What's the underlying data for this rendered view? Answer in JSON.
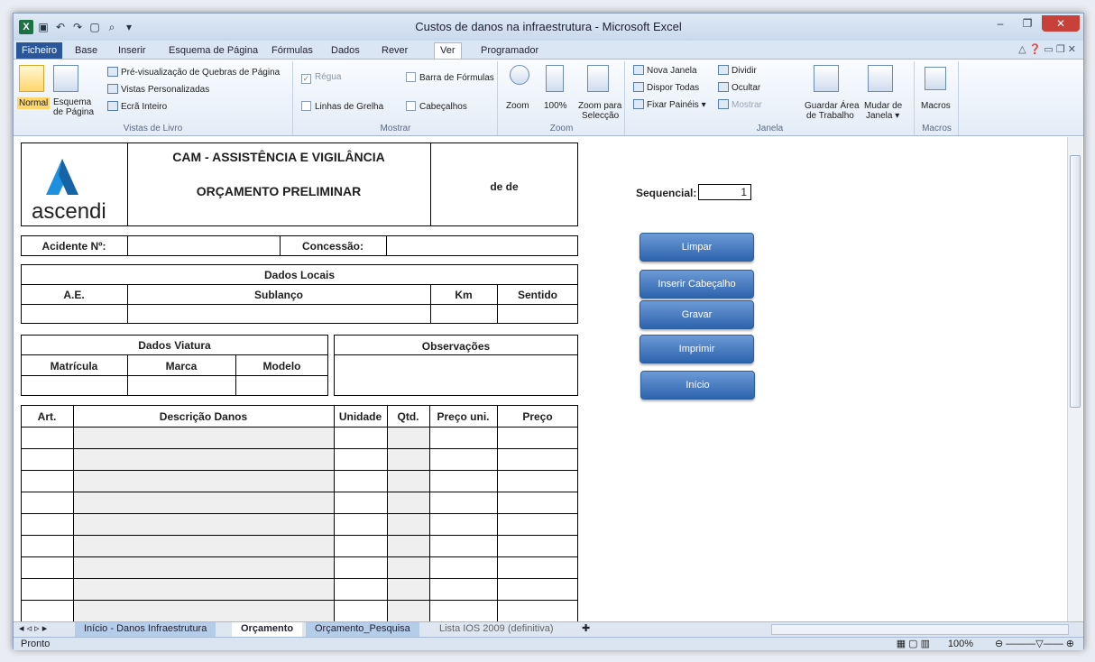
{
  "window": {
    "title": "Custos de danos na infraestrutura - Microsoft Excel"
  },
  "tabs": [
    "Base",
    "Inserir",
    "Esquema de Página",
    "Fórmulas",
    "Dados",
    "Rever",
    "Ver",
    "Programador"
  ],
  "file_tab": "Ficheiro",
  "ribbon": {
    "views": {
      "normal": "Normal",
      "page_layout_1": "Esquema",
      "page_layout_2": "de Página",
      "page_break": "Pré-visualização de Quebras de Página",
      "custom": "Vistas Personalizadas",
      "fullscreen": "Ecrã Inteiro",
      "label": "Vistas de Livro"
    },
    "show": {
      "ruler": "Régua",
      "formula_bar": "Barra de Fórmulas",
      "gridlines": "Linhas de Grelha",
      "headings": "Cabeçalhos",
      "label": "Mostrar"
    },
    "zoom": {
      "zoom": "Zoom",
      "hundred": "100%",
      "zoom_sel_1": "Zoom para",
      "zoom_sel_2": "Selecção",
      "label": "Zoom"
    },
    "window": {
      "new": "Nova Janela",
      "arrange": "Dispor Todas",
      "freeze": "Fixar Painéis ▾",
      "split": "Dividir",
      "hide": "Ocultar",
      "unhide": "Mostrar",
      "save_ws_1": "Guardar Área",
      "save_ws_2": "de Trabalho",
      "switch_1": "Mudar de",
      "switch_2": "Janela ▾",
      "label": "Janela"
    },
    "macros": {
      "macros": "Macros",
      "label": "Macros"
    }
  },
  "form": {
    "company": "CAM - ASSISTÊNCIA E VIGILÂNCIA",
    "doc_title": "ORÇAMENTO PRELIMINAR",
    "date": "de de",
    "logo": "ascendi",
    "accident_label": "Acidente Nº:",
    "concession_label": "Concessão:",
    "local_section": "Dados Locais",
    "local_cols": [
      "A.E.",
      "Sublanço",
      "Km",
      "Sentido"
    ],
    "vehicle_section": "Dados Viatura",
    "vehicle_cols": [
      "Matrícula",
      "Marca",
      "Modelo"
    ],
    "obs_label": "Observações",
    "damage_cols": [
      "Art.",
      "Descrição Danos",
      "Unidade",
      "Qtd.",
      "Preço uni.",
      "Preço"
    ]
  },
  "side": {
    "seq_label": "Sequencial:",
    "seq_value": "1",
    "buttons": [
      "Limpar",
      "Inserir Cabeçalho",
      "Gravar",
      "Imprimir",
      "Início"
    ]
  },
  "sheet_tabs": [
    "Início - Danos Infraestrutura",
    "Orçamento",
    "Orçamento_Pesquisa",
    "Lista IOS 2009 (definitiva)"
  ],
  "status": {
    "ready": "Pronto",
    "zoom": "100%"
  },
  "colors": {
    "file_tab": "#2b579a",
    "button": "#2d63ad",
    "logo": "#1f8fe0"
  }
}
